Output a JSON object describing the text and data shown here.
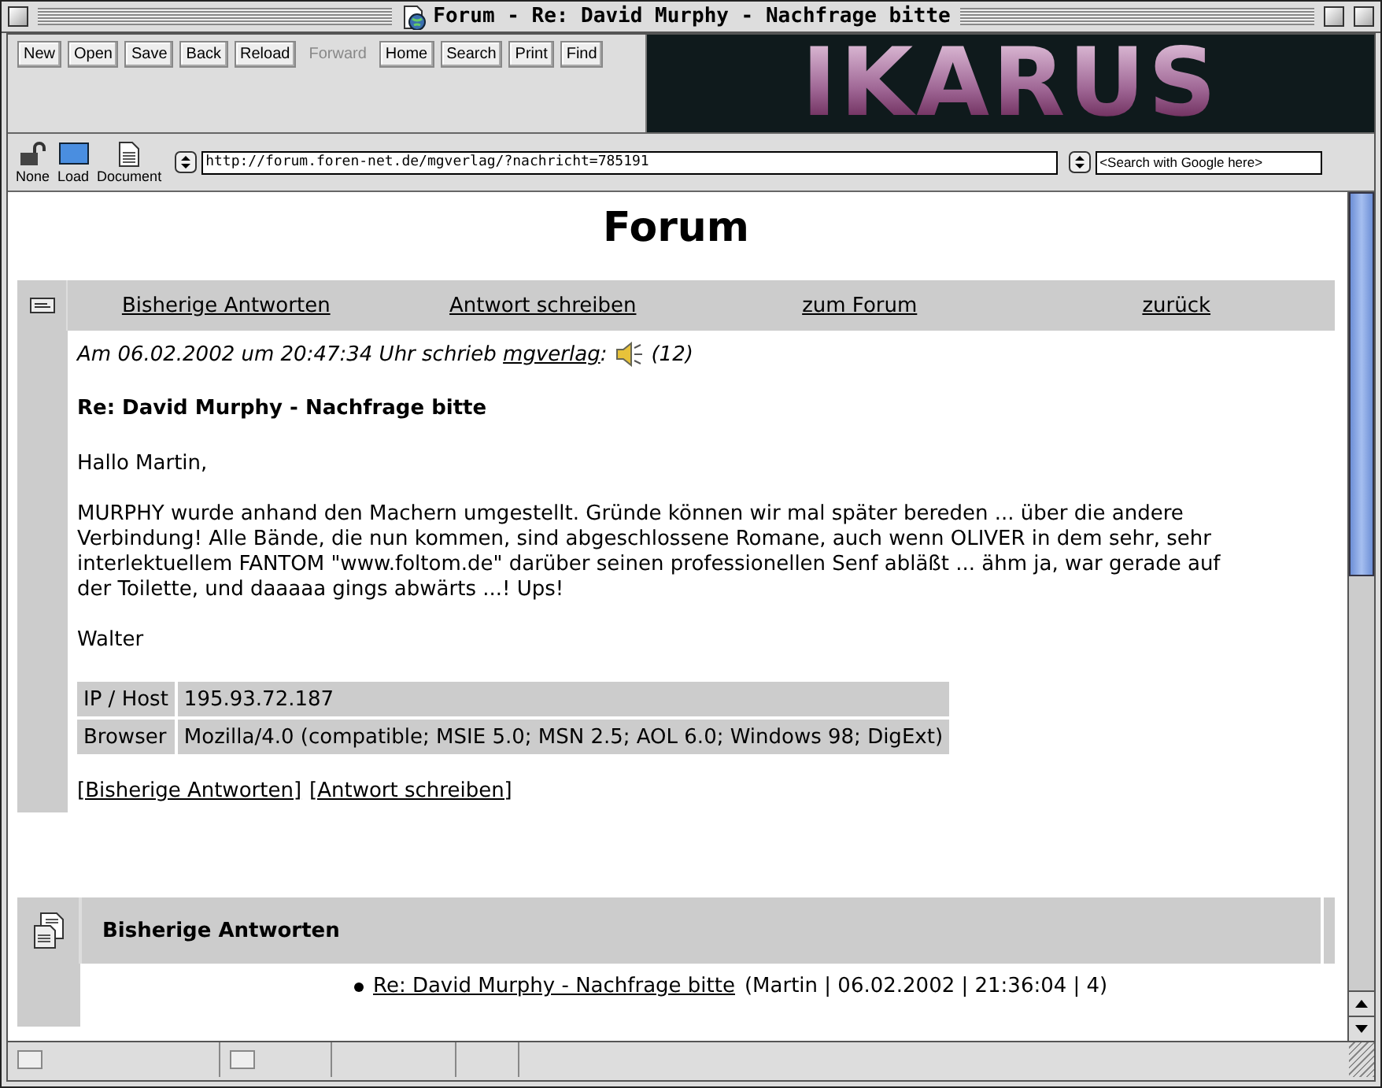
{
  "window": {
    "title": "Forum - Re: David Murphy - Nachfrage bitte"
  },
  "toolbar": {
    "buttons": [
      {
        "label": "New",
        "disabled": false
      },
      {
        "label": "Open",
        "disabled": false
      },
      {
        "label": "Save",
        "disabled": false
      },
      {
        "label": "Back",
        "disabled": false
      },
      {
        "label": "Reload",
        "disabled": false
      },
      {
        "label": "Forward",
        "disabled": true
      },
      {
        "label": "Home",
        "disabled": false
      },
      {
        "label": "Search",
        "disabled": false
      },
      {
        "label": "Print",
        "disabled": false
      },
      {
        "label": "Find",
        "disabled": false
      }
    ],
    "banner": {
      "text": "IKARUS"
    }
  },
  "location_bar": {
    "tools": [
      {
        "kind": "lock",
        "label": "None"
      },
      {
        "kind": "screen",
        "label": "Load"
      },
      {
        "kind": "document",
        "label": "Document"
      }
    ],
    "url": "http://forum.foren-net.de/mgverlag/?nachricht=785191",
    "search": {
      "placeholder": "<Search with Google here>"
    }
  },
  "page": {
    "heading": "Forum",
    "nav": [
      "Bisherige Antworten",
      "Antwort schreiben",
      "zum Forum",
      "zurück"
    ],
    "post": {
      "meta": "Am 06.02.2002 um 20:47:34 Uhr schrieb ",
      "author": "mgverlag",
      "meta_end": ":",
      "count": "(12)",
      "subject": "Re: David Murphy - Nachfrage bitte",
      "paragraphs": [
        "Hallo Martin,",
        "MURPHY wurde anhand den Machern umgestellt. Gründe können wir mal später bereden ... über die andere Verbindung! Alle Bände, die nun kommen, sind abgeschlossene Romane, auch wenn OLIVER in dem sehr, sehr interlektuellem FANTOM \"www.foltom.de\" darüber seinen professionellen Senf abläßt ... ähm ja, war gerade auf der Toilette, und daaaaa gings abwärts ...! Ups!",
        "Walter"
      ],
      "info": [
        {
          "label": "IP / Host",
          "value": "195.93.72.187"
        },
        {
          "label": "Browser",
          "value": "Mozilla/4.0 (compatible; MSIE 5.0; MSN 2.5; AOL 6.0; Windows 98; DigExt)"
        }
      ],
      "links": [
        "[Bisherige Antworten]",
        "[Antwort schreiben]"
      ]
    },
    "replies": {
      "title": "Bisherige Antworten",
      "items": [
        {
          "subject": "Re: David Murphy - Nachfrage bitte",
          "details": "(Martin | 06.02.2002 | 21:36:04 | 4)"
        }
      ]
    }
  }
}
